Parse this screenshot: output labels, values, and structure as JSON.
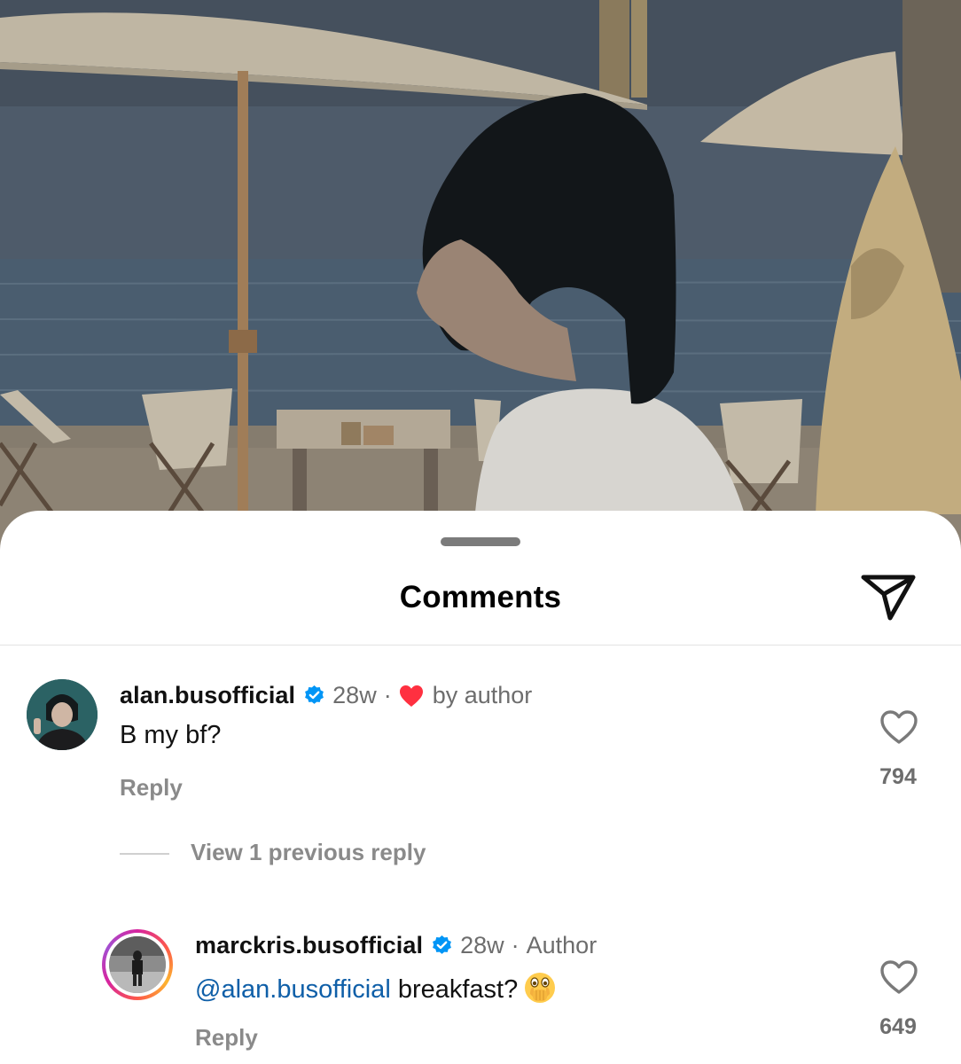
{
  "sheet": {
    "title": "Comments",
    "share_icon": "paper-plane-icon",
    "grabber_icon": "drag-handle"
  },
  "comments": [
    {
      "username": "alan.busofficial",
      "verified": true,
      "time": "28w",
      "separator": "·",
      "liked_by_author_label": "by author",
      "text": "B my bf?",
      "reply_label": "Reply",
      "like_count": "794"
    }
  ],
  "thread": {
    "view_replies_label": "View 1 previous reply"
  },
  "replies": [
    {
      "username": "marckris.busofficial",
      "verified": true,
      "time": "28w",
      "separator": "·",
      "author_badge": "Author",
      "mention": "@alan.busofficial",
      "text": "breakfast?",
      "emoji_icon": "face-with-open-eyes-and-hand-over-mouth-emoji",
      "reply_label": "Reply",
      "like_count": "649",
      "has_story_ring": true
    }
  ],
  "colors": {
    "verified_blue": "#0095f6",
    "author_heart_red": "#ff3040",
    "mention_blue": "#0f5fa8",
    "muted_text": "#6d6d6d"
  }
}
